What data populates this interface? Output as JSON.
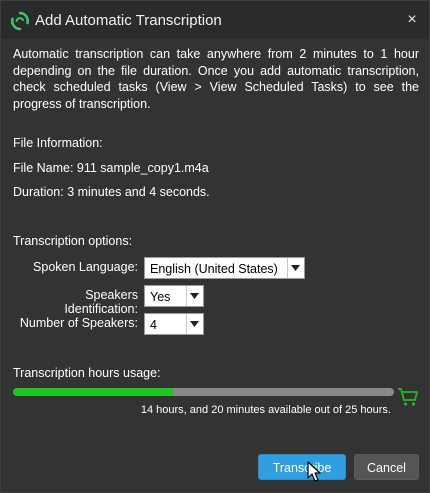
{
  "dialog": {
    "title": "Add Automatic Transcription",
    "close_label": "×",
    "app_icon": "refresh-swirl-icon"
  },
  "intro_text": "Automatic transcription can take anywhere from 2 minutes to 1 hour depending on the file duration. Once you add automatic transcription, check scheduled tasks (View > View Scheduled Tasks) to see the progress of transcription.",
  "file_info": {
    "heading": "File Information:",
    "file_name": "File Name: 911 sample_copy1.m4a",
    "duration": "Duration: 3 minutes and 4 seconds."
  },
  "options": {
    "heading": "Transcription options:",
    "language_label": "Spoken Language:",
    "language_value": "English (United States)",
    "speakers_id_label": "Speakers Identification:",
    "speakers_id_value": "Yes",
    "num_speakers_label": "Number of Speakers:",
    "num_speakers_value": "4"
  },
  "usage": {
    "heading": "Transcription hours usage:",
    "used_fraction": 0.42,
    "summary": "14 hours, and 20 minutes available out of 25 hours.",
    "cart_icon": "shopping-cart-icon"
  },
  "buttons": {
    "transcribe": "Transcribe",
    "cancel": "Cancel"
  },
  "colors": {
    "accent": "#2f9fe0",
    "progress": "#1ec51e",
    "cart": "#22b822",
    "logo": "#3cc86a"
  }
}
